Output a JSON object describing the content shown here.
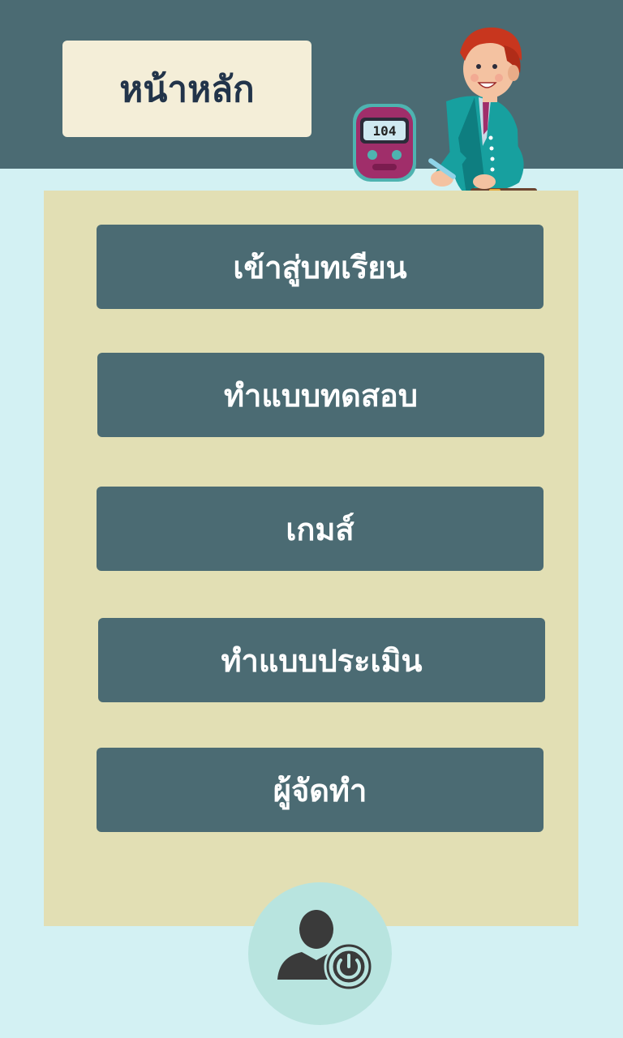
{
  "header": {
    "title": "หน้าหลัก"
  },
  "illustration": {
    "device_display": "104"
  },
  "menu": {
    "items": [
      {
        "label": "เข้าสู่บทเรียน"
      },
      {
        "label": "ทำแบบทดสอบ"
      },
      {
        "label": "เกมส์"
      },
      {
        "label": "ทำแบบประเมิน"
      },
      {
        "label": "ผู้จัดทำ"
      }
    ]
  },
  "colors": {
    "header_bg": "#4b6b73",
    "page_bg": "#d3f1f3",
    "panel_bg": "#e2dfb4",
    "button_bg": "#4b6b73",
    "title_bg": "#f4eed8",
    "logout_circle": "#b8e4df"
  },
  "icons": {
    "logout": "user-power-icon"
  }
}
